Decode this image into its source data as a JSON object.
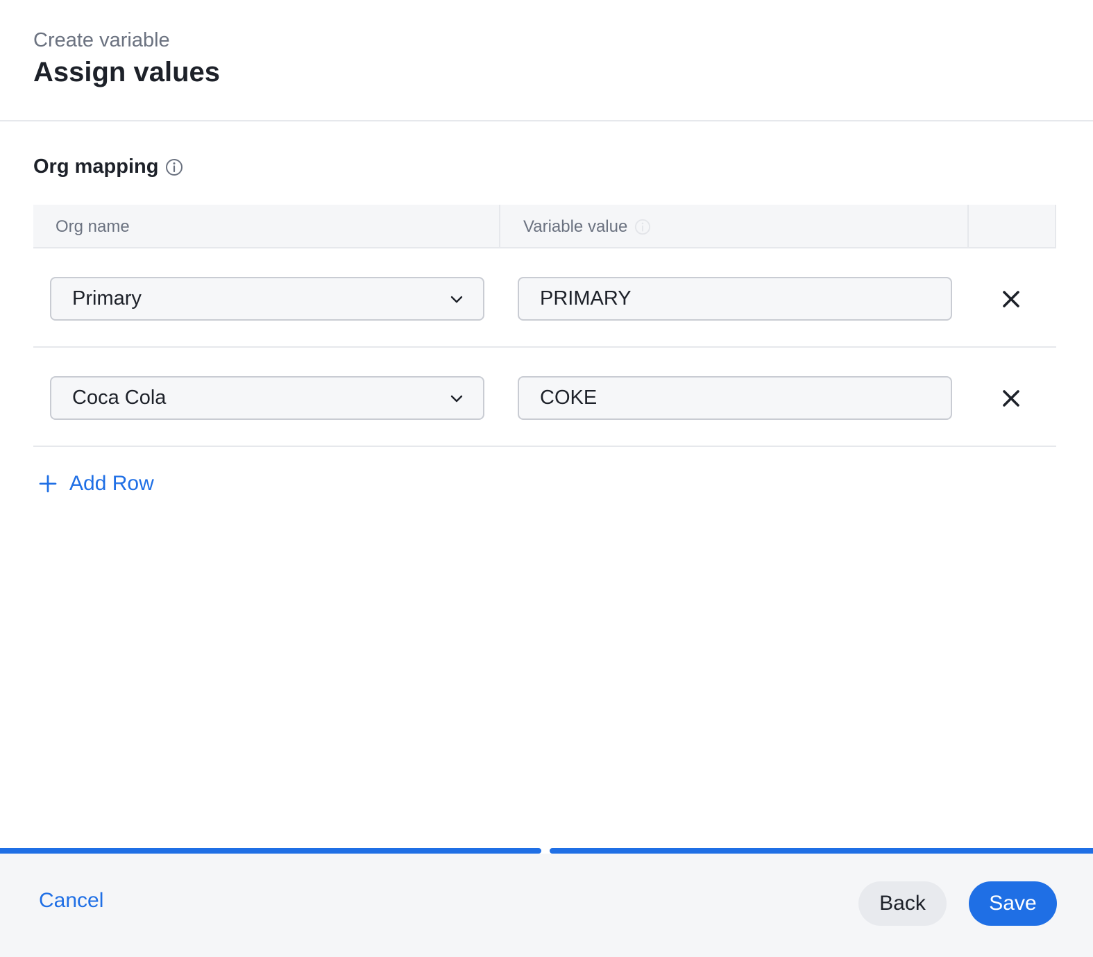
{
  "header": {
    "subtitle": "Create variable",
    "title": "Assign values"
  },
  "section": {
    "title": "Org mapping",
    "info_icon": "info-circle-icon"
  },
  "table": {
    "columns": [
      "Org name",
      "Variable value",
      ""
    ],
    "rows": [
      {
        "org_name": "Primary",
        "variable_value": "PRIMARY"
      },
      {
        "org_name": "Coca Cola",
        "variable_value": "COKE"
      }
    ],
    "add_row_label": "Add Row"
  },
  "progress": {
    "steps_total": 2,
    "steps_completed": 2
  },
  "footer": {
    "cancel_label": "Cancel",
    "back_label": "Back",
    "save_label": "Save"
  },
  "colors": {
    "accent": "#1f6fe5",
    "text": "#1d2129",
    "muted": "#6b7280",
    "border": "#c9ccd3"
  }
}
